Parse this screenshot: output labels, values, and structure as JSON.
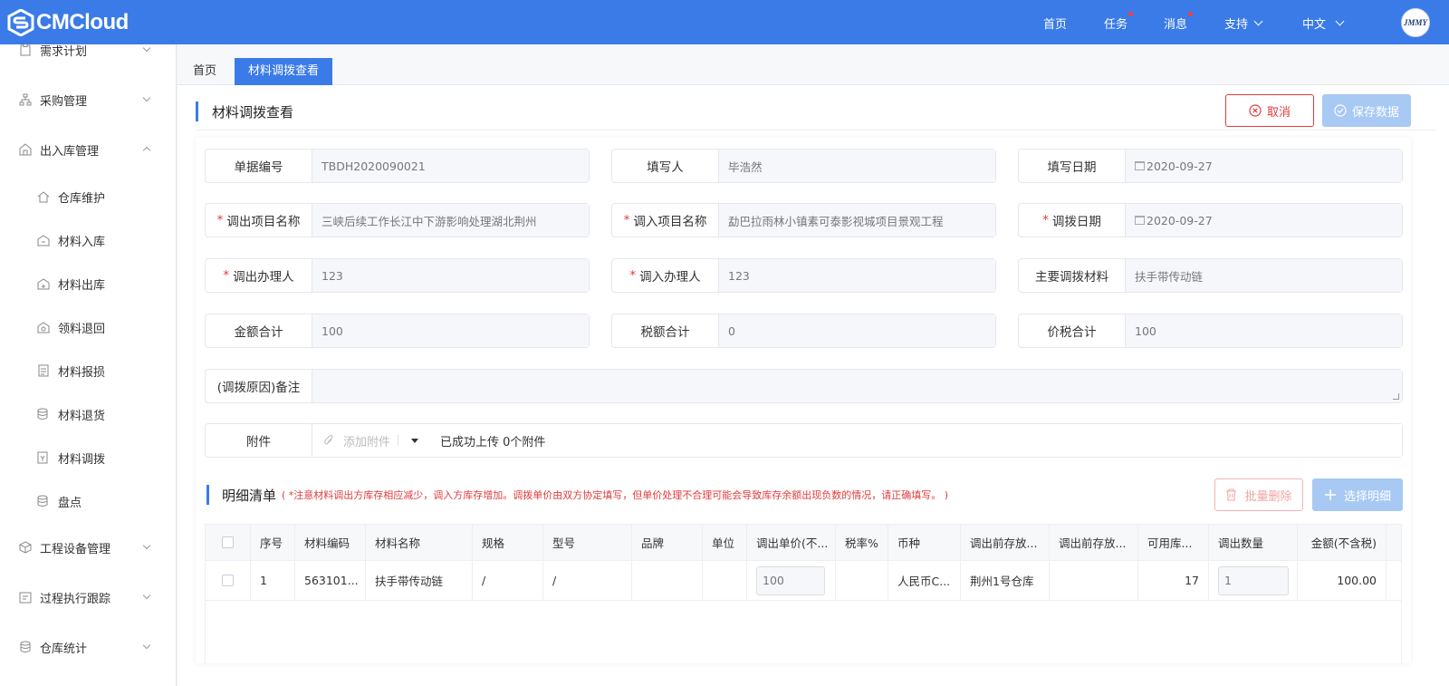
{
  "header": {
    "logo_text": "CMCloud",
    "nav": [
      {
        "label": "首页",
        "dot": false
      },
      {
        "label": "任务",
        "dot": true
      },
      {
        "label": "消息",
        "dot": true
      },
      {
        "label": "支持",
        "dot": false
      },
      {
        "label": "中文",
        "dot": false
      }
    ],
    "avatar_text": "JMMY"
  },
  "sidebar": {
    "items": [
      {
        "label": "需求计划",
        "icon": "clipboard-icon"
      },
      {
        "label": "采购管理",
        "icon": "org-chart-icon"
      },
      {
        "label": "出入库管理",
        "icon": "warehouse-icon"
      },
      {
        "label": "仓库维护",
        "icon": "house-icon"
      },
      {
        "label": "材料入库",
        "icon": "stock-in-icon"
      },
      {
        "label": "材料出库",
        "icon": "stock-out-icon"
      },
      {
        "label": "领料退回",
        "icon": "return-icon"
      },
      {
        "label": "材料报损",
        "icon": "document-icon"
      },
      {
        "label": "材料退货",
        "icon": "coins-icon"
      },
      {
        "label": "材料调拨",
        "icon": "transfer-icon"
      },
      {
        "label": "盘点",
        "icon": "database-icon"
      },
      {
        "label": "工程设备管理",
        "icon": "cube-icon"
      },
      {
        "label": "过程执行跟踪",
        "icon": "tracking-icon"
      },
      {
        "label": "仓库统计",
        "icon": "stats-icon"
      }
    ]
  },
  "tabs": [
    {
      "label": "首页"
    },
    {
      "label": "材料调拨查看"
    }
  ],
  "page": {
    "title": "材料调拨查看",
    "cancel_label": "取消",
    "save_label": "保存数据"
  },
  "form": {
    "doc_no": {
      "label": "单据编号",
      "value": "TBDH2020090021"
    },
    "writer": {
      "label": "填写人",
      "value": "毕浩然"
    },
    "write_date": {
      "label": "填写日期",
      "value": "2020-09-27"
    },
    "out_project": {
      "label": "调出项目名称",
      "value": "三峡后续工作长江中下游影响处理湖北荆州"
    },
    "in_project": {
      "label": "调入项目名称",
      "value": "勐巴拉雨林小镇素可泰影视城项目景观工程"
    },
    "transfer_date": {
      "label": "调拨日期",
      "value": "2020-09-27"
    },
    "out_handler": {
      "label": "调出办理人",
      "value": "123"
    },
    "in_handler": {
      "label": "调入办理人",
      "value": "123"
    },
    "main_material": {
      "label": "主要调拨材料",
      "value": "扶手带传动链"
    },
    "amount_total": {
      "label": "金额合计",
      "value": "100"
    },
    "tax_total": {
      "label": "税额合计",
      "value": "0"
    },
    "price_tax_total": {
      "label": "价税合计",
      "value": "100"
    },
    "remark": {
      "label": "(调拨原因)备注",
      "value": ""
    },
    "attachment": {
      "label": "附件",
      "add_label": "添加附件",
      "status": "已成功上传 0个附件"
    },
    "required_mark": "*"
  },
  "detail": {
    "title": "明细清单",
    "note": "( *注意材料调出方库存相应减少，调入方库存增加。调拨单价由双方协定填写，但单价处理不合理可能会导致库存余额出现负数的情况，请正确填写。 )",
    "batch_delete_label": "批量删除",
    "select_label": "选择明细",
    "columns": [
      "序号",
      "材料编码",
      "材料名称",
      "规格",
      "型号",
      "品牌",
      "单位",
      "调出单价(不...",
      "税率%",
      "币种",
      "调出前存放...",
      "调出前存放...",
      "可用库...",
      "调出数量",
      "金额(不含税)"
    ],
    "rows": [
      {
        "seq": "1",
        "code": "563101...",
        "name": "扶手带传动链",
        "spec": "/",
        "model": "/",
        "brand": "",
        "unit": "",
        "price": "100",
        "tax": "",
        "currency": "人民币C...",
        "store1": "荆州1号仓库",
        "store2": "",
        "avail": "17",
        "qty": "1",
        "amount": "100.00"
      }
    ]
  },
  "colors": {
    "primary": "#3a7be8",
    "danger": "#e03c3c",
    "disabled": "#a7c9f3"
  }
}
